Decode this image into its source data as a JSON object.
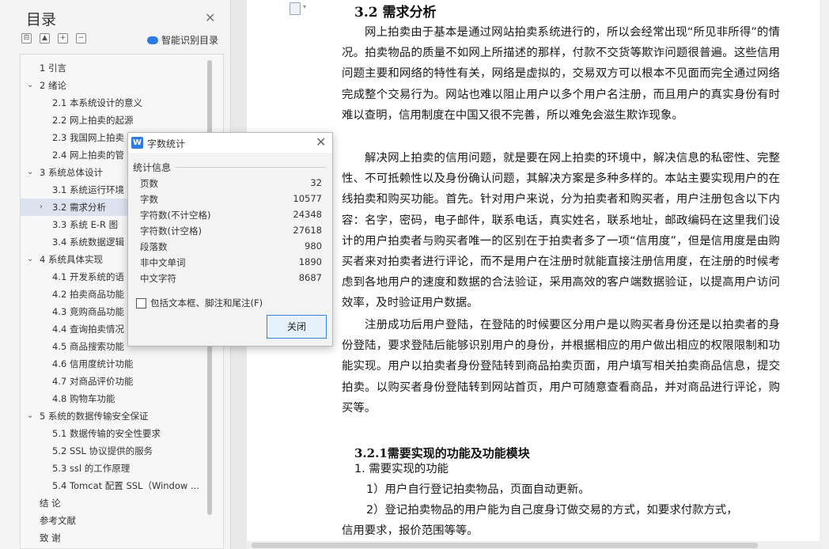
{
  "sidebar": {
    "title": "目录",
    "smart_label": "智能识别目录",
    "tools": [
      "⊟",
      "▲",
      "+",
      "−"
    ],
    "items": [
      {
        "label": "1  引言",
        "indent": 0,
        "arrow": ""
      },
      {
        "label": "2  绪论",
        "indent": 0,
        "arrow": "⌄"
      },
      {
        "label": "2.1  本系统设计的意义",
        "indent": 1,
        "arrow": ""
      },
      {
        "label": "2.2  网上拍卖的起源",
        "indent": 1,
        "arrow": ""
      },
      {
        "label": "2.3  我国网上拍卖",
        "indent": 1,
        "arrow": ""
      },
      {
        "label": "2.4  网上拍卖的管",
        "indent": 1,
        "arrow": ""
      },
      {
        "label": "3  系统总体设计",
        "indent": 0,
        "arrow": "⌄"
      },
      {
        "label": "3.1  系统运行环境",
        "indent": 1,
        "arrow": ""
      },
      {
        "label": "3.2  需求分析",
        "indent": 1,
        "arrow": "›"
      },
      {
        "label": "3.3  系统 E-R 图",
        "indent": 1,
        "arrow": ""
      },
      {
        "label": "3.4 系统数据逻辑",
        "indent": 1,
        "arrow": ""
      },
      {
        "label": "4 系统具体实现",
        "indent": 0,
        "arrow": "⌄"
      },
      {
        "label": "4.1 开发系统的语",
        "indent": 1,
        "arrow": ""
      },
      {
        "label": "4.2  拍卖商品功能",
        "indent": 1,
        "arrow": ""
      },
      {
        "label": "4.3 竞购商品功能",
        "indent": 1,
        "arrow": ""
      },
      {
        "label": "4.4 查询拍卖情况",
        "indent": 1,
        "arrow": ""
      },
      {
        "label": "4.5 商品搜索功能",
        "indent": 1,
        "arrow": ""
      },
      {
        "label": "4.6 信用度统计功能",
        "indent": 1,
        "arrow": ""
      },
      {
        "label": "4.7 对商品评价功能",
        "indent": 1,
        "arrow": ""
      },
      {
        "label": "4.8 购物车功能",
        "indent": 1,
        "arrow": ""
      },
      {
        "label": "5  系统的数据传输安全保证",
        "indent": 0,
        "arrow": "⌄"
      },
      {
        "label": "5.1  数据传输的安全性要求",
        "indent": 1,
        "arrow": ""
      },
      {
        "label": "5.2 SSL 协议提供的服务",
        "indent": 1,
        "arrow": ""
      },
      {
        "label": "5.3 ssl 的工作原理",
        "indent": 1,
        "arrow": ""
      },
      {
        "label": "5.4 Tomcat 配置 SSL（Window ...",
        "indent": 1,
        "arrow": ""
      },
      {
        "label": "结      论",
        "indent": -1,
        "arrow": ""
      },
      {
        "label": "参考文献",
        "indent": -1,
        "arrow": ""
      },
      {
        "label": "致      谢",
        "indent": -1,
        "arrow": ""
      }
    ]
  },
  "doc": {
    "heading": "3.2  需求分析",
    "para1": "网上拍卖由于基本是通过网站拍卖系统进行的，所以会经常出现“所见非所得”的情况。拍卖物品的质量不如网上所描述的那样，付款不交货等欺诈问题很普遍。这些信用问题主要和网络的特性有关，网络是虚拟的，交易双方可以根本不见面而完全通过网络完成整个交易行为。网站也难以阻止用户以多个用户名注册，而且用户的真实身份有时难以查明，信用制度在中国又很不完善，所以难免会滋生欺诈现象。",
    "para2": "解决网上拍卖的信用问题，就是要在网上拍卖的环境中，解决信息的私密性、完整性、不可抵赖性以及身份确认问题，其解决方案是多种多样的。本站主要实现用户的在线拍卖和购买功能。首先。针对用户来说，分为拍卖者和购买者，用户注册包含以下内容：名字，密码，电子邮件，联系电话，真实姓名，联系地址，邮政编码在这里我们设计的用户拍卖者与购买者唯一的区别在于拍卖者多了一项“信用度”，但是信用度是由购买者来对拍卖者进行评论，而不是用户在注册时就能直接注册信用度，在注册的时候考虑到各地用户的速度和数据的合法验证，采用高效的客户端数据验证，以提高用户访问效率，及时验证用户数据。",
    "para3": "注册成功后用户登陆，在登陆的时候要区分用户是以购买者身份还是以拍卖者的身份登陆，要求登陆后能够识别用户的身份，并根据相应的用户做出相应的权限限制和功能实现。用户以拍卖者身份登陆转到商品拍卖页面，用户填写相关拍卖商品信息，提交拍卖。以购买者身份登陆转到网站首页，用户可随意查看商品，并对商品进行评论，购买等。",
    "sub_heading": "3.2.1需要实现的功能及功能模块",
    "line1": "1.  需要实现的功能",
    "line2": "1）用户自行登记拍卖物品，页面自动更新。",
    "line3": "2）登记拍卖物品的用户能为自己度身订做交易的方式，如要求付款方式，",
    "line4": "信用要求，报价范围等等。"
  },
  "dialog": {
    "logo": "W",
    "title": "字数统计",
    "group": "统计信息",
    "stats": [
      {
        "label": "页数",
        "value": "32"
      },
      {
        "label": "字数",
        "value": "10577"
      },
      {
        "label": "字符数(不计空格)",
        "value": "24348"
      },
      {
        "label": "字符数(计空格)",
        "value": "27618"
      },
      {
        "label": "段落数",
        "value": "980"
      },
      {
        "label": "非中文单词",
        "value": "1890"
      },
      {
        "label": "中文字符",
        "value": "8687"
      }
    ],
    "checkbox_label": "包括文本框、脚注和尾注(F)",
    "close_button": "关闭"
  }
}
